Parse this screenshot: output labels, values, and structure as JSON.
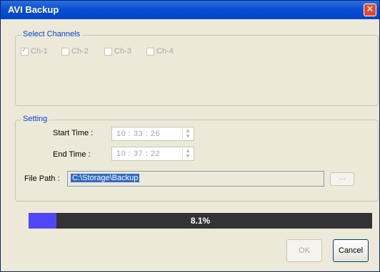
{
  "window": {
    "title": "AVI Backup",
    "close_glyph": "✕"
  },
  "channels_group": {
    "legend": "Select Channels",
    "items": [
      {
        "label": "Ch-1",
        "checked": true
      },
      {
        "label": "Ch-2",
        "checked": false
      },
      {
        "label": "Ch-3",
        "checked": false
      },
      {
        "label": "Ch-4",
        "checked": false
      }
    ]
  },
  "setting_group": {
    "legend": "Setting",
    "start_label": "Start Time :",
    "start_value": "10 : 33 : 26",
    "end_label": "End Time :",
    "end_value": "10 : 37 : 22",
    "path_label": "File Path :",
    "path_value": "C:\\Storage\\Backup",
    "browse_label": "..."
  },
  "progress": {
    "percent": 8.1,
    "text": "8.1%",
    "fill_color": "#5146f5"
  },
  "buttons": {
    "ok": "OK",
    "cancel": "Cancel"
  }
}
